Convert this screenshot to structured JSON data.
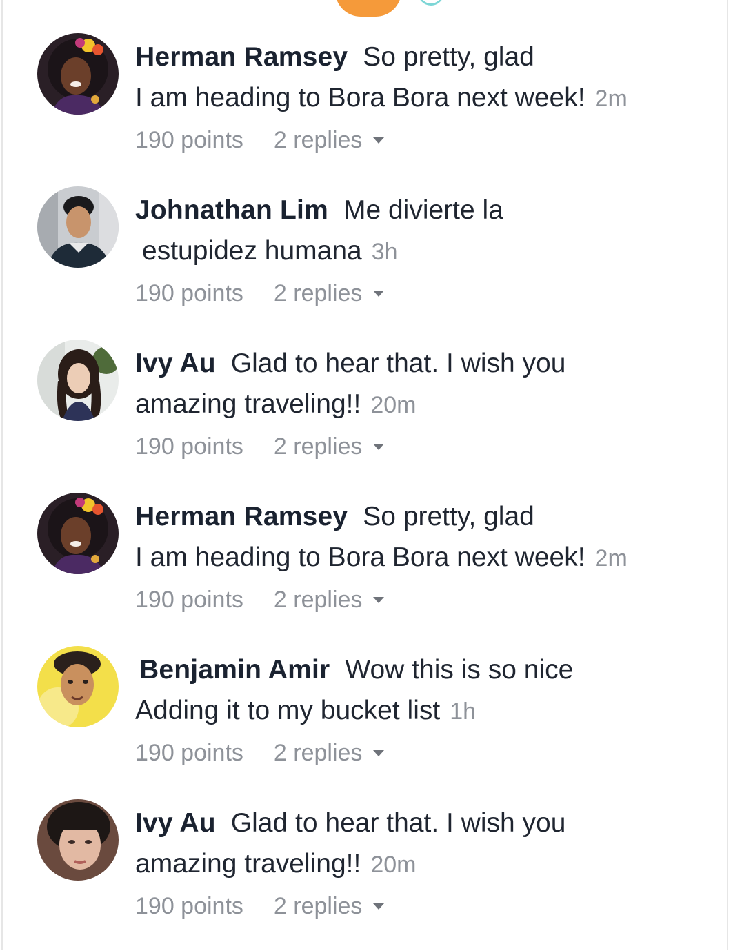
{
  "comments": [
    {
      "author": "Herman Ramsey",
      "text_line1": "So pretty, glad",
      "text_line2": "I am heading to Bora Bora next week!",
      "time": "2m",
      "points": "190 points",
      "replies": "2 replies",
      "avatar": "herman-ramsey-avatar"
    },
    {
      "author": "Johnathan Lim",
      "text_line1": "Me divierte la",
      "text_line2": "estupidez humana",
      "time": "3h",
      "points": "190 points",
      "replies": "2 replies",
      "avatar": "johnathan-lim-avatar"
    },
    {
      "author": "Ivy Au",
      "text_line1": "Glad to hear that. I wish you",
      "text_line2": "amazing traveling!!",
      "time": "20m",
      "points": "190 points",
      "replies": "2 replies",
      "avatar": "ivy-au-avatar"
    },
    {
      "author": "Herman Ramsey",
      "text_line1": "So pretty, glad",
      "text_line2": "I am heading to Bora Bora next week!",
      "time": "2m",
      "points": "190 points",
      "replies": "2 replies",
      "avatar": "herman-ramsey-avatar"
    },
    {
      "author": "Benjamin Amir",
      "text_line1": "Wow this is so nice",
      "text_line2": "Adding it to my bucket list",
      "time": "1h",
      "points": "190 points",
      "replies": "2 replies",
      "avatar": "benjamin-amir-avatar"
    },
    {
      "author": "Ivy Au",
      "text_line1": "Glad to hear that. I wish you",
      "text_line2": "amazing traveling!!",
      "time": "20m",
      "points": "190 points",
      "replies": "2 replies",
      "avatar": "ivy-au-avatar-2"
    }
  ],
  "colors": {
    "author": "#1a2230",
    "text": "#1f2530",
    "meta": "#8e9299",
    "accent_orange": "#f59a3a",
    "accent_teal": "#7dd6d6"
  },
  "icons": {
    "replies_toggle": "caret-down-icon"
  }
}
